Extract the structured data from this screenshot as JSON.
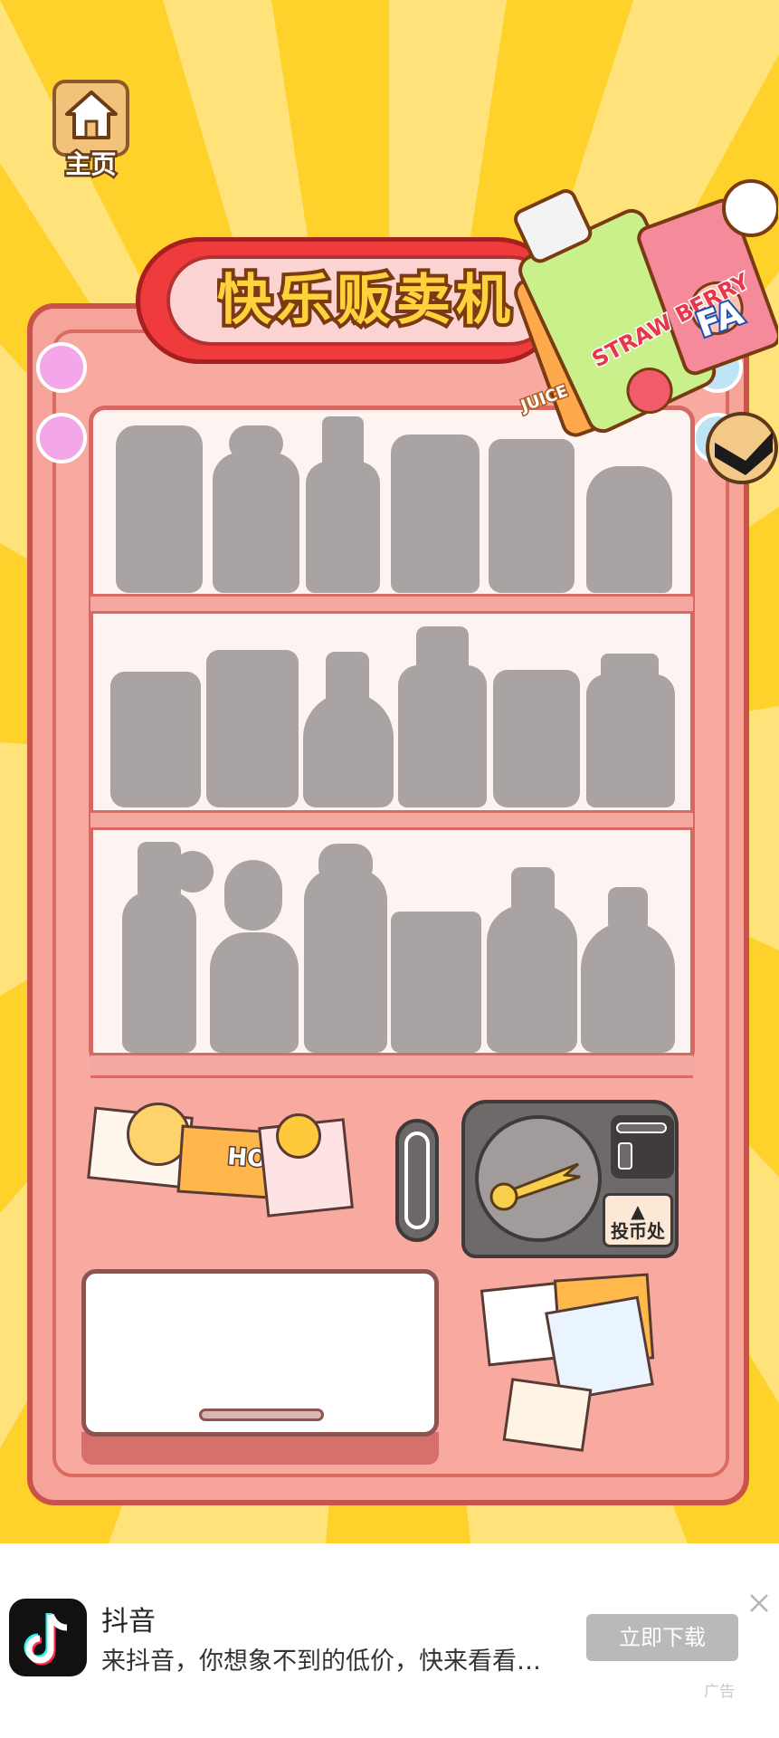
{
  "game": {
    "home_label": "主页",
    "title": "快乐贩卖机",
    "coin_label": "投币处",
    "coin_arrow": "▲",
    "colors": {
      "background_yellow": "#ffe27a",
      "ray_yellow": "#ffd12b",
      "machine_pink": "#f6a39a",
      "title_red": "#ef3b3b",
      "silhouette_gray": "#a9a4a3"
    },
    "shelves": [
      {
        "items": [
          "bottle",
          "jar",
          "bottle",
          "can",
          "can",
          "bottle"
        ]
      },
      {
        "items": [
          "can",
          "can",
          "bottle",
          "bottle",
          "can",
          "can"
        ]
      },
      {
        "items": [
          "bottle",
          "bottle",
          "bottle",
          "can",
          "bottle",
          "bottle"
        ]
      }
    ],
    "drink_stickers": [
      {
        "text": "STRAW BERRY",
        "icon": "strawberry-juice-icon"
      },
      {
        "text": "FA",
        "icon": "soda-can-icon"
      },
      {
        "text": "JUICE",
        "icon": "juice-carton-icon"
      }
    ],
    "poster_text": "HOI"
  },
  "ad": {
    "app_name": "抖音",
    "description": "来抖音，你想象不到的低价，快来看看…",
    "button_label": "立即下载",
    "ad_tag": "广告",
    "icon": "tiktok-icon",
    "close_icon": "close-icon"
  }
}
